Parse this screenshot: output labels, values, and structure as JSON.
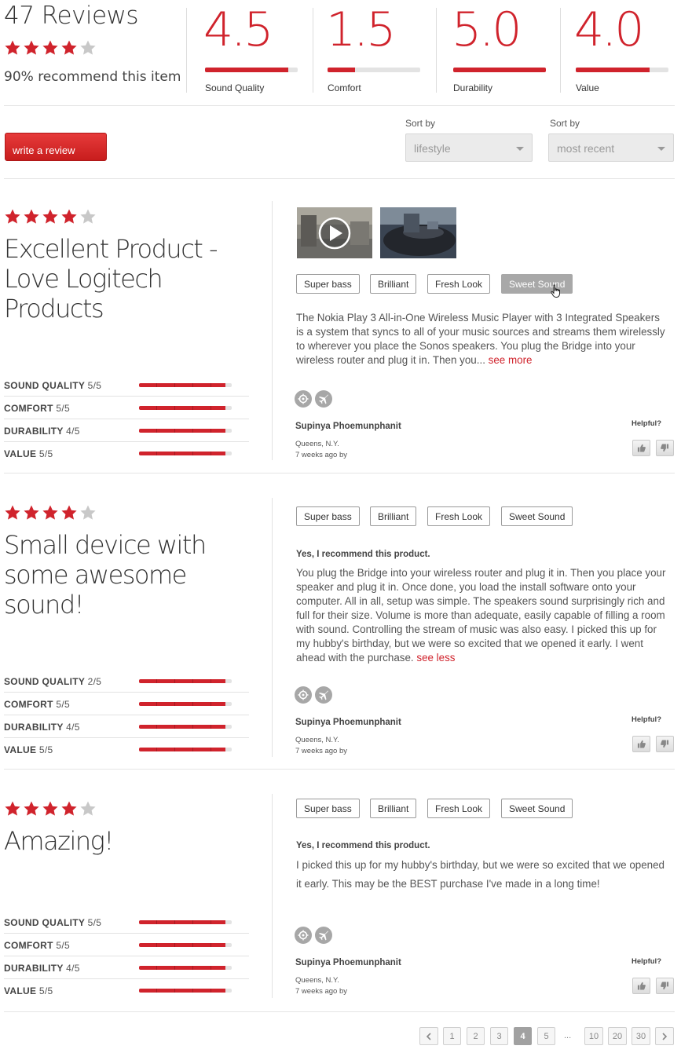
{
  "summary": {
    "title": "47 Reviews",
    "stars": 4,
    "stars_max": 5,
    "recommend_text": "90% recommend this item",
    "metrics": [
      {
        "value": "4.5",
        "label": "Sound Quality",
        "fill": 0.9
      },
      {
        "value": "1.5",
        "label": "Comfort",
        "fill": 0.3
      },
      {
        "value": "5.0",
        "label": "Durability",
        "fill": 1.0
      },
      {
        "value": "4.0",
        "label": "Value",
        "fill": 0.8
      }
    ]
  },
  "controls": {
    "write_review_label": "write a review",
    "sort1": {
      "label": "Sort by",
      "value": "lifestyle"
    },
    "sort2": {
      "label": "Sort by",
      "value": "most recent"
    }
  },
  "reviews": [
    {
      "stars": 4,
      "title": "Excellent Product - Love Logitech Products",
      "ratings": [
        {
          "label": "SOUND QUALITY",
          "score": "5/5",
          "fill": 0.93
        },
        {
          "label": "COMFORT",
          "score": "5/5",
          "fill": 0.93
        },
        {
          "label": "DURABILITY",
          "score": "4/5",
          "fill": 0.93
        },
        {
          "label": "VALUE",
          "score": "5/5",
          "fill": 0.93
        }
      ],
      "tags": [
        "Super bass",
        "Brilliant",
        "Fresh Look",
        "Sweet Sound"
      ],
      "active_tag": 3,
      "has_media": true,
      "recommend": "",
      "body": "The Nokia Play 3 All-in-One Wireless Music Player with 3 Integrated Speakers is a system that syncs to all of your music sources and streams them wirelessly to wherever you place the Sonos speakers. You plug the Bridge into your wireless router and plug it in. Then you...",
      "toggle_link": "see more",
      "author": "Supinya Phoemunphanit",
      "location": "Queens, N.Y.",
      "time": "7 weeks ago by",
      "helpful_label": "Helpful?"
    },
    {
      "stars": 4,
      "title": "Small device with some awesome sound!",
      "ratings": [
        {
          "label": "SOUND QUALITY",
          "score": "2/5",
          "fill": 0.93
        },
        {
          "label": "COMFORT",
          "score": "5/5",
          "fill": 0.93
        },
        {
          "label": "DURABILITY",
          "score": "4/5",
          "fill": 0.93
        },
        {
          "label": "VALUE",
          "score": "5/5",
          "fill": 0.93
        }
      ],
      "tags": [
        "Super bass",
        "Brilliant",
        "Fresh Look",
        "Sweet Sound"
      ],
      "active_tag": -1,
      "has_media": false,
      "recommend": "Yes, I recommend this product.",
      "body": "You plug the Bridge into your wireless router and plug it in. Then you place your speaker and plug it in. Once done, you load the install software onto your computer. All in all, setup was simple. The speakers sound surprisingly rich and full for their size. Volume is more than adequate, easily capable of filling a room with sound. Controlling the stream of music was also easy. I picked this up for my hubby's birthday, but we were so excited that we opened it early. I went ahead with the purchase.",
      "toggle_link": "see less",
      "author": "Supinya Phoemunphanit",
      "location": "Queens, N.Y.",
      "time": "7 weeks ago by",
      "helpful_label": "Helpful?"
    },
    {
      "stars": 4,
      "title": "Amazing!",
      "ratings": [
        {
          "label": "SOUND QUALITY",
          "score": "5/5",
          "fill": 0.93
        },
        {
          "label": "COMFORT",
          "score": "5/5",
          "fill": 0.93
        },
        {
          "label": "DURABILITY",
          "score": "4/5",
          "fill": 0.93
        },
        {
          "label": "VALUE",
          "score": "5/5",
          "fill": 0.93
        }
      ],
      "tags": [
        "Super bass",
        "Brilliant",
        "Fresh Look",
        "Sweet Sound"
      ],
      "active_tag": -1,
      "has_media": false,
      "recommend": "Yes, I recommend this product.",
      "body": "I picked this up for my hubby's birthday, but we were so excited that we opened it early. This may be the BEST purchase I've made in a long time!",
      "toggle_link": "",
      "author": "Supinya Phoemunphanit",
      "location": "Queens, N.Y.",
      "time": "7 weeks ago by",
      "helpful_label": "Helpful?"
    }
  ],
  "pagination": {
    "prev_icon": "chevron-left-icon",
    "next_icon": "chevron-right-icon",
    "pages": [
      "1",
      "2",
      "3",
      "4",
      "5",
      "...",
      "10",
      "20",
      "30"
    ],
    "current": "4"
  },
  "colors": {
    "accent": "#d0232c",
    "star_empty": "#c8c8c8",
    "tag_active": "#a8a8a8"
  }
}
